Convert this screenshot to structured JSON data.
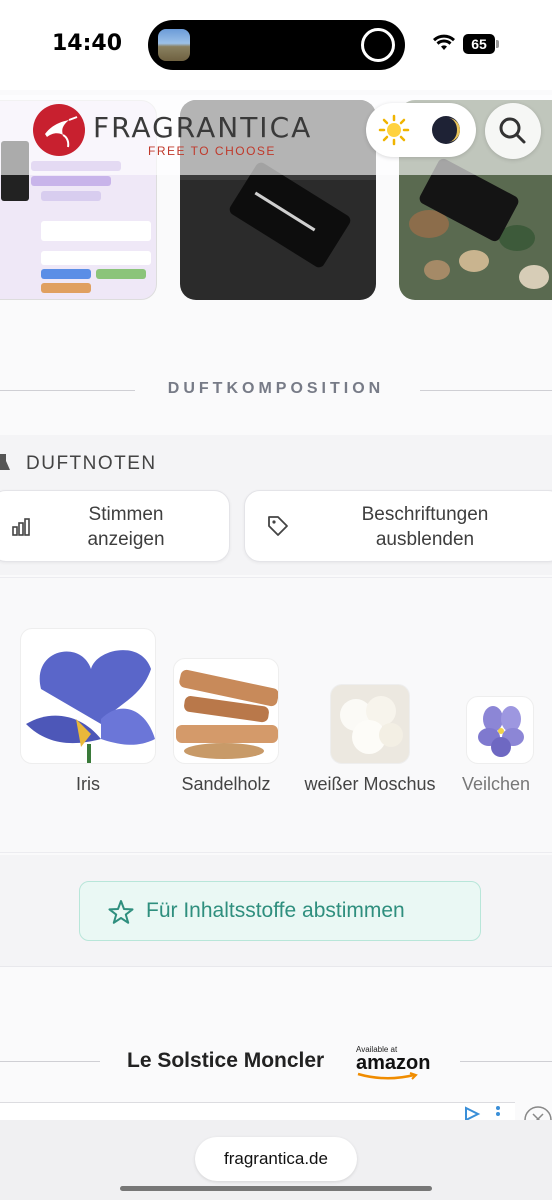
{
  "status_bar": {
    "time": "14:40",
    "battery": "65"
  },
  "header": {
    "brand": "FRAGRANTICA",
    "tagline": "FREE TO CHOOSE",
    "theme_light_icon": "sun-icon",
    "theme_dark_icon": "moon-icon",
    "search_icon": "search-icon",
    "colors": {
      "brand_red": "#c8202f",
      "tagline_red": "#c0392b"
    }
  },
  "composition": {
    "section_title": "DUFTKOMPOSITION",
    "notes_title": "DUFTNOTEN",
    "buttons": {
      "votes_label": "Stimmen anzeigen",
      "labels_label": "Beschriftungen ausblenden"
    },
    "notes": [
      {
        "name": "Iris"
      },
      {
        "name": "Sandelholz"
      },
      {
        "name": "weißer Moschus"
      },
      {
        "name": "Veilchen"
      }
    ],
    "vote_button": "Für Inhaltsstoffe abstimmen",
    "accent_color": "#2f8f7e"
  },
  "ad": {
    "title": "Le Solstice Moncler",
    "store_available": "Available at",
    "store_name": "amazon"
  },
  "browser": {
    "url": "fragrantica.de"
  }
}
